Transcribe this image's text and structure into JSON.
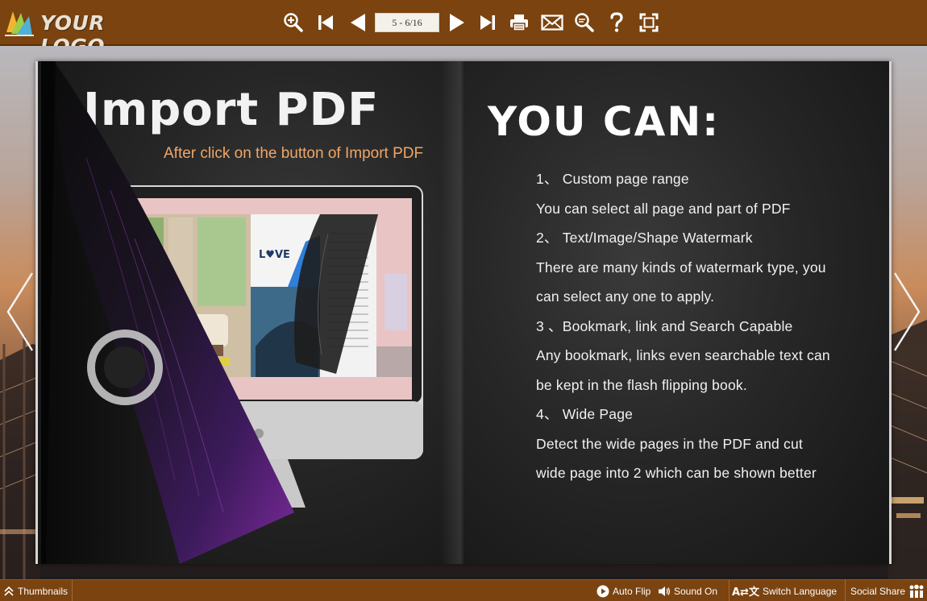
{
  "header": {
    "logo_text": "YOUR LOGO",
    "page_indicator": "5 - 6/16",
    "tools": [
      {
        "name": "zoom-in-icon"
      },
      {
        "name": "first-page-icon"
      },
      {
        "name": "previous-page-icon"
      },
      {
        "name": "next-page-icon"
      },
      {
        "name": "last-page-icon"
      },
      {
        "name": "print-icon"
      },
      {
        "name": "email-icon"
      },
      {
        "name": "search-icon"
      },
      {
        "name": "help-icon"
      },
      {
        "name": "fullscreen-icon"
      }
    ]
  },
  "left_page": {
    "title": "Import PDF",
    "subtitle": "After click on the button of Import PDF",
    "screen_logo": "L♥VE"
  },
  "right_page": {
    "title": "YOU CAN:",
    "lines": [
      "1、 Custom page range",
      "You can select all page and part of PDF",
      "2、 Text/Image/Shape Watermark",
      "There are many kinds of watermark type, you",
      "can select any one to apply.",
      "3 、Bookmark, link and Search Capable",
      "Any bookmark, links even searchable text can",
      "be kept in the flash flipping book.",
      "4、 Wide Page",
      "Detect the wide pages in the PDF and cut",
      "wide page into 2 which can be shown better"
    ]
  },
  "footer": {
    "thumbnails": "Thumbnails",
    "auto_flip": "Auto Flip",
    "sound": "Sound On",
    "switch_language": "Switch Language",
    "social_share": "Social Share"
  },
  "colors": {
    "bar": "#7a4310",
    "subtitle_orange": "#f0a668"
  }
}
